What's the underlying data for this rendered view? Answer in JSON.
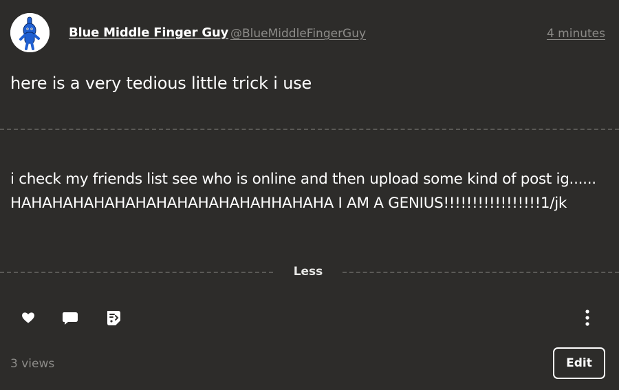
{
  "post": {
    "author": {
      "name": "Blue Middle Finger Guy",
      "handle": "@BlueMiddleFingerGuy",
      "avatar_icon": "blue-figure-avatar"
    },
    "timestamp": "4 minutes",
    "title": "here is a very tedious little trick i use",
    "body": "i check my friends list see who is online and then upload some kind of post ig......HAHAHAHAHAHAHAHAHAHAHAHAHHAHAHA I AM A GENIUS!!!!!!!!!!!!!!!!!1/jk",
    "toggle_label": "Less",
    "actions": {
      "like_icon": "heart-icon",
      "reply_icon": "speech-bubble-icon",
      "remix_icon": "remix-icon",
      "more_icon": "more-vertical-icon"
    },
    "views": "3 views",
    "edit_label": "Edit"
  },
  "colors": {
    "background": "#2d2c2a",
    "text": "#ffffff",
    "muted": "#8c8b88",
    "divider": "#5a5956",
    "avatar_figure": "#1f5fd1"
  }
}
